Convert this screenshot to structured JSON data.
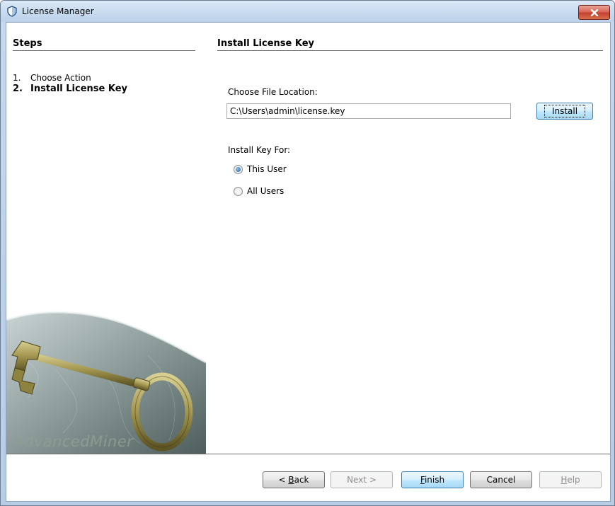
{
  "window": {
    "title": "License Manager"
  },
  "steps": {
    "heading": "Steps",
    "items": [
      {
        "number": "1.",
        "label": "Choose Action"
      },
      {
        "number": "2.",
        "label": "Install License Key"
      }
    ]
  },
  "branding": {
    "text": "AdvancedMiner"
  },
  "panel": {
    "heading": "Install License Key",
    "file_label": "Choose File Location:",
    "file_value": "C:\\Users\\admin\\license.key",
    "install_button": "Install",
    "install_for_label": "Install Key For:",
    "options": [
      {
        "label": "This User",
        "selected": true
      },
      {
        "label": "All Users",
        "selected": false
      }
    ]
  },
  "footer": {
    "back": {
      "prefix": "< ",
      "mnemonic": "B",
      "rest": "ack"
    },
    "next": "Next >",
    "finish": {
      "mnemonic": "F",
      "rest": "inish"
    },
    "cancel": "Cancel",
    "help": {
      "mnemonic": "H",
      "rest": "elp"
    }
  },
  "colors": {
    "close_button": "#c4412f",
    "default_button_border": "#3c7fb1"
  }
}
